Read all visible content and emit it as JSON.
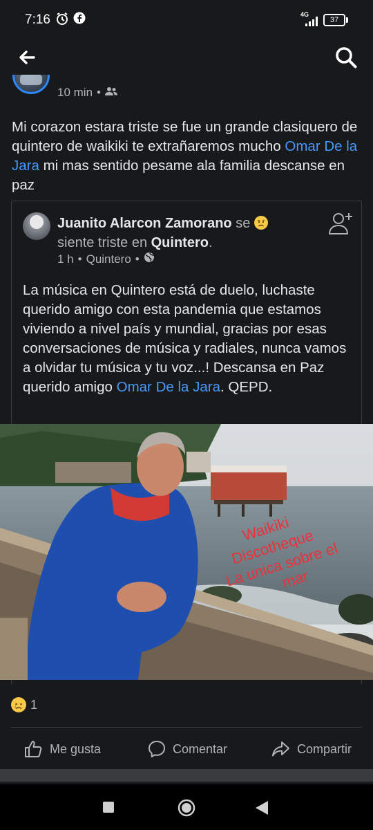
{
  "status_bar": {
    "time": "7:16",
    "network": "4G",
    "battery": "37"
  },
  "top_bar": {
    "back_icon": "arrow-left-icon",
    "search_icon": "search-icon"
  },
  "post": {
    "time": "10 min",
    "audience_icon": "friends-icon",
    "text_part1": "Mi corazon estara triste se fue un grande clasiquero de quintero  de waikiki te extrañaremos mucho ",
    "mention": "Omar De la Jara",
    "text_part2": "   mi mas sentido pesame ala familia descanse en paz"
  },
  "shared_post": {
    "author": "Juanito Alarcon Zamorano",
    "feeling_prefix": " se ",
    "feeling_text": " siente triste en ",
    "location": "Quintero",
    "feeling_suffix": ".",
    "time": "1 h",
    "place": "Quintero",
    "audience_icon": "globe-icon",
    "text": "La música en Quintero está de duelo, luchaste querido amigo con esta pandemia que estamos viviendo a nivel país y mundial, gracias por esas conversaciones de música y radiales, nunca vamos a olvidar tu música y tu voz...! Descansa en Paz querido amigo ",
    "mention": "Omar De la Jara",
    "text_end": ". QEPD.",
    "photo_caption_lines": [
      "Waikiki",
      "Discotheque",
      "La unica sobre el",
      "mar"
    ]
  },
  "reactions": {
    "icon": "sad-reaction-icon",
    "count": "1"
  },
  "actions": {
    "like": "Me gusta",
    "comment": "Comentar",
    "share": "Compartir"
  },
  "colors": {
    "background": "#18191a",
    "text": "#e4e6eb",
    "muted": "#b0b3b8",
    "link": "#4599ff",
    "caption_red": "#e8323c"
  }
}
